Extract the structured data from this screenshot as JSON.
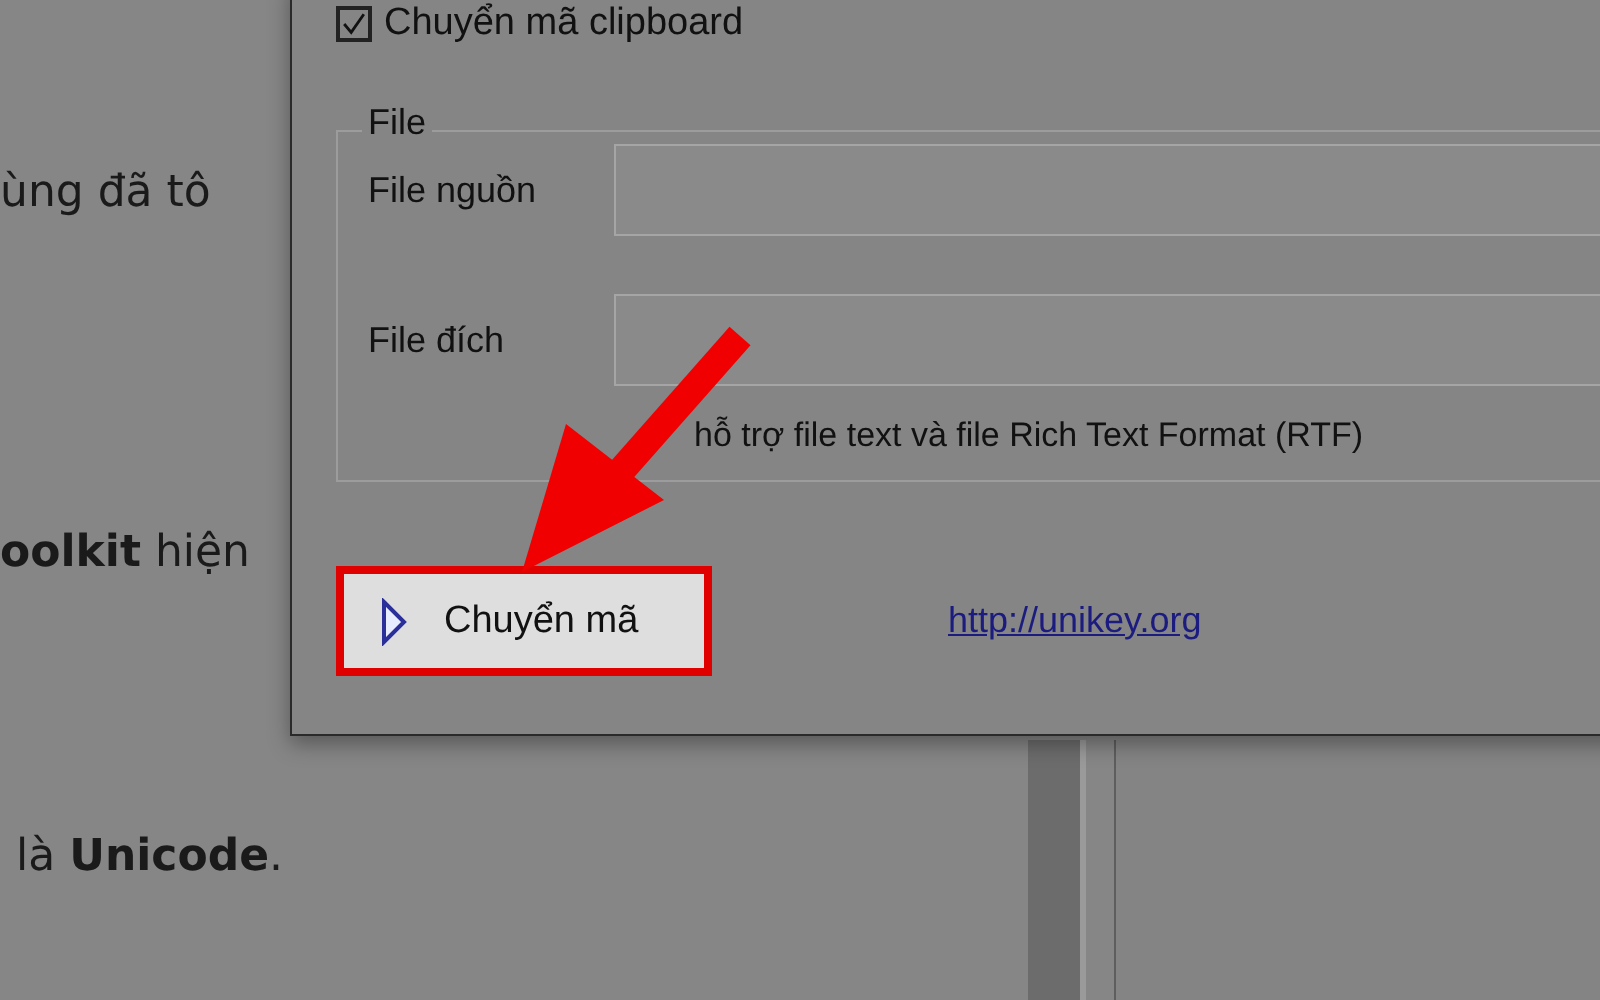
{
  "background_page": {
    "lines": [
      "ùng đã tô",
      "**oolkit** hiện",
      "là **Unicode**."
    ]
  },
  "dialog": {
    "clipboard_option": {
      "label": "Chuyển mã clipboard",
      "checked": true
    },
    "file_group": {
      "title": "File",
      "fields": [
        {
          "label": "File nguồn"
        },
        {
          "label": "File đích"
        }
      ],
      "note": "hỗ trợ file text và file Rich Text Format (RTF)"
    },
    "convert_button": {
      "label": "Chuyển mã",
      "highlighted": true
    },
    "link": "http://unikey.org"
  }
}
